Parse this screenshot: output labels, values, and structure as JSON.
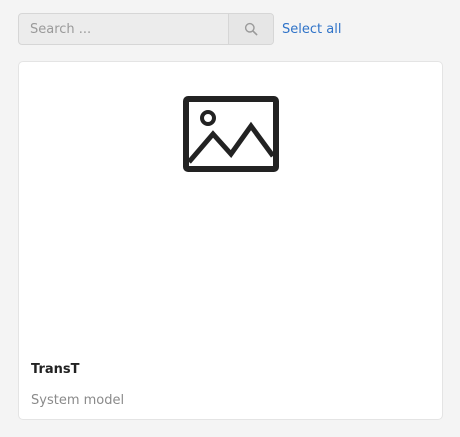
{
  "search": {
    "value": "",
    "placeholder": "Search ..."
  },
  "toolbar": {
    "select_all_label": "Select all"
  },
  "cards": [
    {
      "title": "TransT",
      "subtitle": "System model",
      "thumbnail_icon": "image-placeholder-icon"
    }
  ],
  "colors": {
    "link": "#2f73c8",
    "background": "#f4f4f4",
    "card": "#ffffff"
  }
}
